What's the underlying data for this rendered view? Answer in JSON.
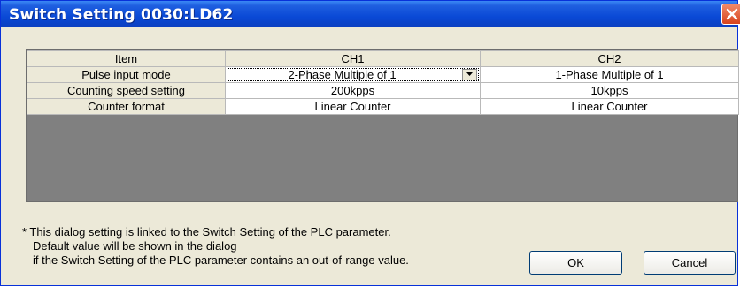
{
  "window": {
    "title": "Switch Setting 0030:LD62"
  },
  "table": {
    "headers": [
      "Item",
      "CH1",
      "CH2"
    ],
    "rows": [
      {
        "item": "Pulse input mode",
        "ch1": "2-Phase Multiple of 1",
        "ch2": "1-Phase Multiple of 1"
      },
      {
        "item": "Counting speed setting",
        "ch1": "200kpps",
        "ch2": "10kpps"
      },
      {
        "item": "Counter format",
        "ch1": "Linear Counter",
        "ch2": "Linear Counter"
      }
    ]
  },
  "note": {
    "line1": "* This dialog setting is linked to the Switch Setting of the PLC parameter.",
    "line2": "Default value will be shown in the dialog",
    "line3": "if the Switch Setting of the PLC parameter contains an out-of-range value."
  },
  "buttons": {
    "ok": "OK",
    "cancel": "Cancel"
  },
  "colors": {
    "titlebar": "#0a49d6",
    "dialog_bg": "#ece9d8",
    "grid_empty": "#808080",
    "close_button": "#d8431c"
  },
  "icons": {
    "close": "close-icon",
    "dropdown": "chevron-down-icon"
  }
}
